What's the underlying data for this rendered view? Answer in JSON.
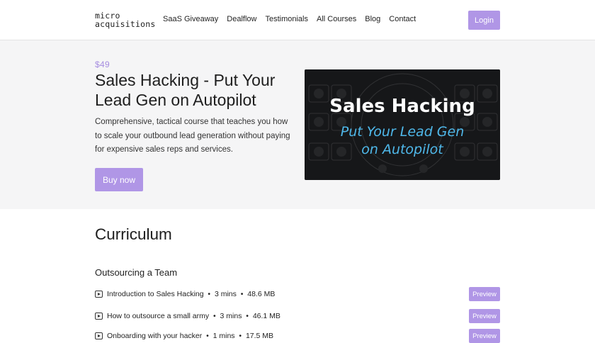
{
  "header": {
    "logo_line1": "micro",
    "logo_line2": "acquisitions",
    "nav": [
      "SaaS Giveaway",
      "Dealflow",
      "Testimonials",
      "All Courses",
      "Blog",
      "Contact"
    ],
    "login_label": "Login"
  },
  "hero": {
    "price": "$49",
    "title": "Sales Hacking - Put Your Lead Gen on Autopilot",
    "description": "Comprehensive, tactical course that teaches you how to scale your outbound lead generation without paying for expensive sales reps and services.",
    "buy_label": "Buy now",
    "image_title": "Sales Hacking",
    "image_subtitle_line1": "Put Your Lead Gen",
    "image_subtitle_line2": "on Autopilot"
  },
  "curriculum": {
    "title": "Curriculum",
    "section_title": "Outsourcing a Team",
    "lessons": [
      {
        "name": "Introduction to Sales Hacking",
        "duration": "3 mins",
        "size": "48.6 MB",
        "preview_label": "Preview"
      },
      {
        "name": "How to outsource a small army",
        "duration": "3 mins",
        "size": "46.1 MB",
        "preview_label": "Preview"
      },
      {
        "name": "Onboarding with your hacker",
        "duration": "1 mins",
        "size": "17.5 MB",
        "preview_label": "Preview"
      }
    ],
    "separator": "•"
  },
  "colors": {
    "accent": "#b096e6",
    "price": "#a68de0",
    "hero_bg": "#f5f5f6",
    "image_title": "#ffffff",
    "image_subtitle": "#4fb8ea"
  }
}
